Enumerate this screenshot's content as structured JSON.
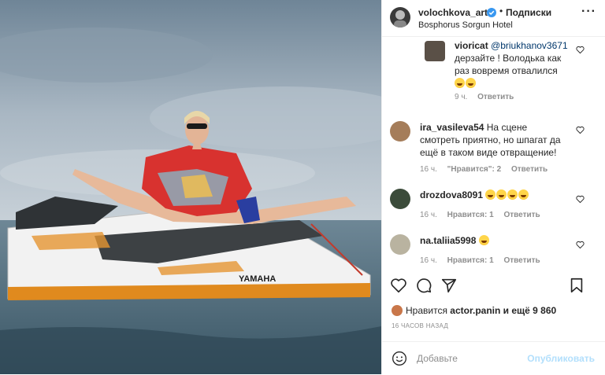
{
  "post": {
    "username": "volochkova_art",
    "follow_dot": "•",
    "follow_label": "Подписки",
    "location": "Bosphorus Sorgun Hotel",
    "more_icon": "more-horizontal-icon",
    "photo_brand": "YAMAHA"
  },
  "comments": [
    {
      "username": "vioricat",
      "mention": "@briukhanov3671",
      "text_line1": "дерзайте ! Володька как",
      "text_line2": "раз вовремя отвалился",
      "emoji_count": 2,
      "time": "9 ч.",
      "likes": "",
      "reply": "Ответить"
    },
    {
      "username": "ira_vasileva54",
      "text_line1": "На сцене",
      "text_line2": "смотреть приятно, но шпагат да",
      "text_line3": "ещё в таком виде отвращение!",
      "time": "16 ч.",
      "likes": "\"Нравится\": 2",
      "reply": "Ответить"
    },
    {
      "username": "drozdova8091",
      "emoji_count": 4,
      "time": "16 ч.",
      "likes": "Нравится: 1",
      "reply": "Ответить"
    },
    {
      "username": "na.taliia5998",
      "emoji_count": 1,
      "time": "16 ч.",
      "likes": "Нравится: 1",
      "reply": "Ответить"
    }
  ],
  "likes": {
    "prefix": "Нравится",
    "user": "actor.panin",
    "suffix": "и ещё 9 860"
  },
  "timestamp": "16 ЧАСОВ НАЗАД",
  "add_comment": {
    "placeholder": "Добавьте",
    "publish": "Опубликовать"
  },
  "colors": {
    "verified": "#3897f0",
    "link": "#00376b",
    "muted": "#8e8e8e",
    "publish_disabled": "#b2dffc"
  }
}
